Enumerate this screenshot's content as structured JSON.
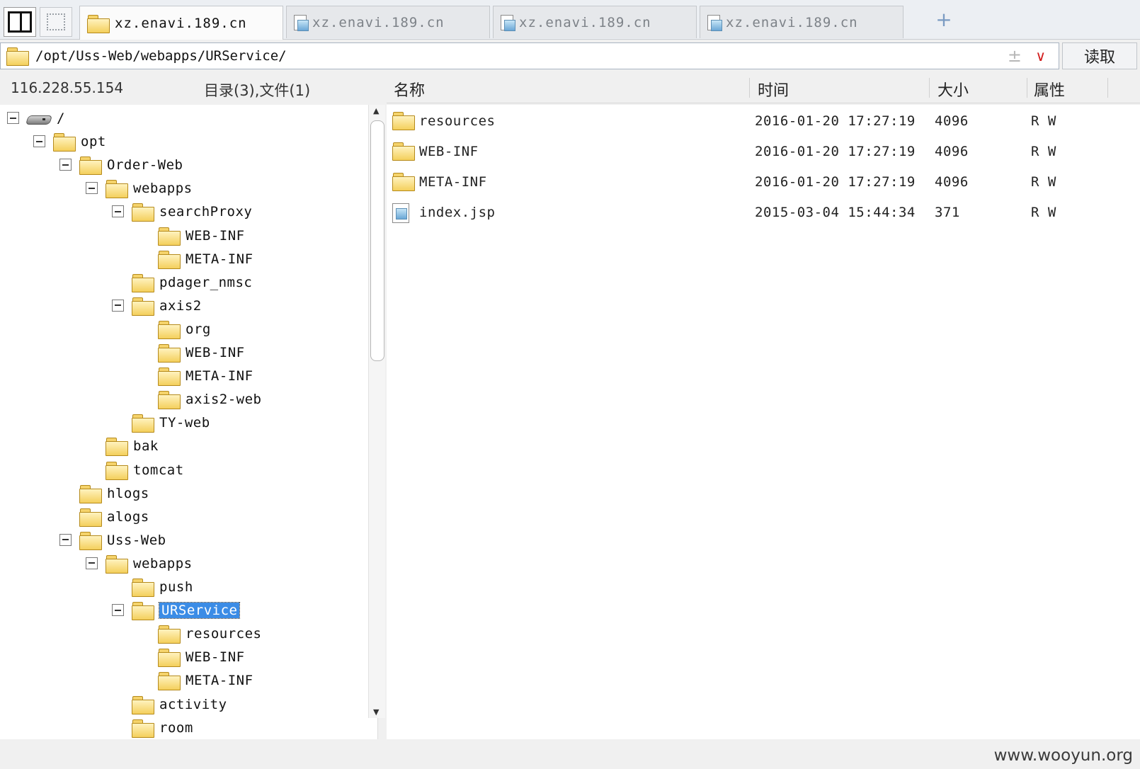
{
  "tabs": [
    {
      "label": "xz.enavi.189.cn",
      "active": true
    },
    {
      "label": "xz.enavi.189.cn",
      "active": false
    },
    {
      "label": "xz.enavi.189.cn",
      "active": false
    },
    {
      "label": "xz.enavi.189.cn",
      "active": false
    }
  ],
  "tab_add_label": "+",
  "address": {
    "path": "/opt/Uss-Web/webapps/URService/",
    "plus_glyph": "±",
    "dropdown_glyph": "∨",
    "read_button": "读取"
  },
  "left_header": {
    "ip": "116.228.55.154",
    "counts": "目录(3),文件(1)"
  },
  "tree": [
    {
      "label": "/",
      "type": "drive",
      "level": 0,
      "expanded": true
    },
    {
      "label": "opt",
      "type": "folder",
      "level": 1,
      "expanded": true
    },
    {
      "label": "Order-Web",
      "type": "folder",
      "level": 2,
      "expanded": true
    },
    {
      "label": "webapps",
      "type": "folder",
      "level": 3,
      "expanded": true
    },
    {
      "label": "searchProxy",
      "type": "folder",
      "level": 4,
      "expanded": true
    },
    {
      "label": "WEB-INF",
      "type": "folder",
      "level": 5
    },
    {
      "label": "META-INF",
      "type": "folder",
      "level": 5
    },
    {
      "label": "pdager_nmsc",
      "type": "folder",
      "level": 4
    },
    {
      "label": "axis2",
      "type": "folder",
      "level": 4,
      "expanded": true
    },
    {
      "label": "org",
      "type": "folder",
      "level": 5
    },
    {
      "label": "WEB-INF",
      "type": "folder",
      "level": 5
    },
    {
      "label": "META-INF",
      "type": "folder",
      "level": 5
    },
    {
      "label": "axis2-web",
      "type": "folder",
      "level": 5
    },
    {
      "label": "TY-web",
      "type": "folder",
      "level": 4
    },
    {
      "label": "bak",
      "type": "folder",
      "level": 3
    },
    {
      "label": "tomcat",
      "type": "folder",
      "level": 3
    },
    {
      "label": "hlogs",
      "type": "folder",
      "level": 2
    },
    {
      "label": "alogs",
      "type": "folder",
      "level": 2
    },
    {
      "label": "Uss-Web",
      "type": "folder",
      "level": 2,
      "expanded": true
    },
    {
      "label": "webapps",
      "type": "folder",
      "level": 3,
      "expanded": true
    },
    {
      "label": "push",
      "type": "folder",
      "level": 4
    },
    {
      "label": "URService",
      "type": "folder",
      "level": 4,
      "expanded": true,
      "selected": true
    },
    {
      "label": "resources",
      "type": "folder",
      "level": 5
    },
    {
      "label": "WEB-INF",
      "type": "folder",
      "level": 5
    },
    {
      "label": "META-INF",
      "type": "folder",
      "level": 5
    },
    {
      "label": "activity",
      "type": "folder",
      "level": 4
    },
    {
      "label": "room",
      "type": "folder",
      "level": 4
    }
  ],
  "list_columns": {
    "name": "名称",
    "time": "时间",
    "size": "大小",
    "attr": "属性"
  },
  "files": [
    {
      "name": "resources",
      "type": "folder",
      "time": "2016-01-20 17:27:19",
      "size": "4096",
      "attr": "R W"
    },
    {
      "name": "WEB-INF",
      "type": "folder",
      "time": "2016-01-20 17:27:19",
      "size": "4096",
      "attr": "R W"
    },
    {
      "name": "META-INF",
      "type": "folder",
      "time": "2016-01-20 17:27:19",
      "size": "4096",
      "attr": "R W"
    },
    {
      "name": "index.jsp",
      "type": "file",
      "time": "2015-03-04 15:44:34",
      "size": "371",
      "attr": "R W"
    }
  ],
  "watermark": "www.wooyun.org"
}
